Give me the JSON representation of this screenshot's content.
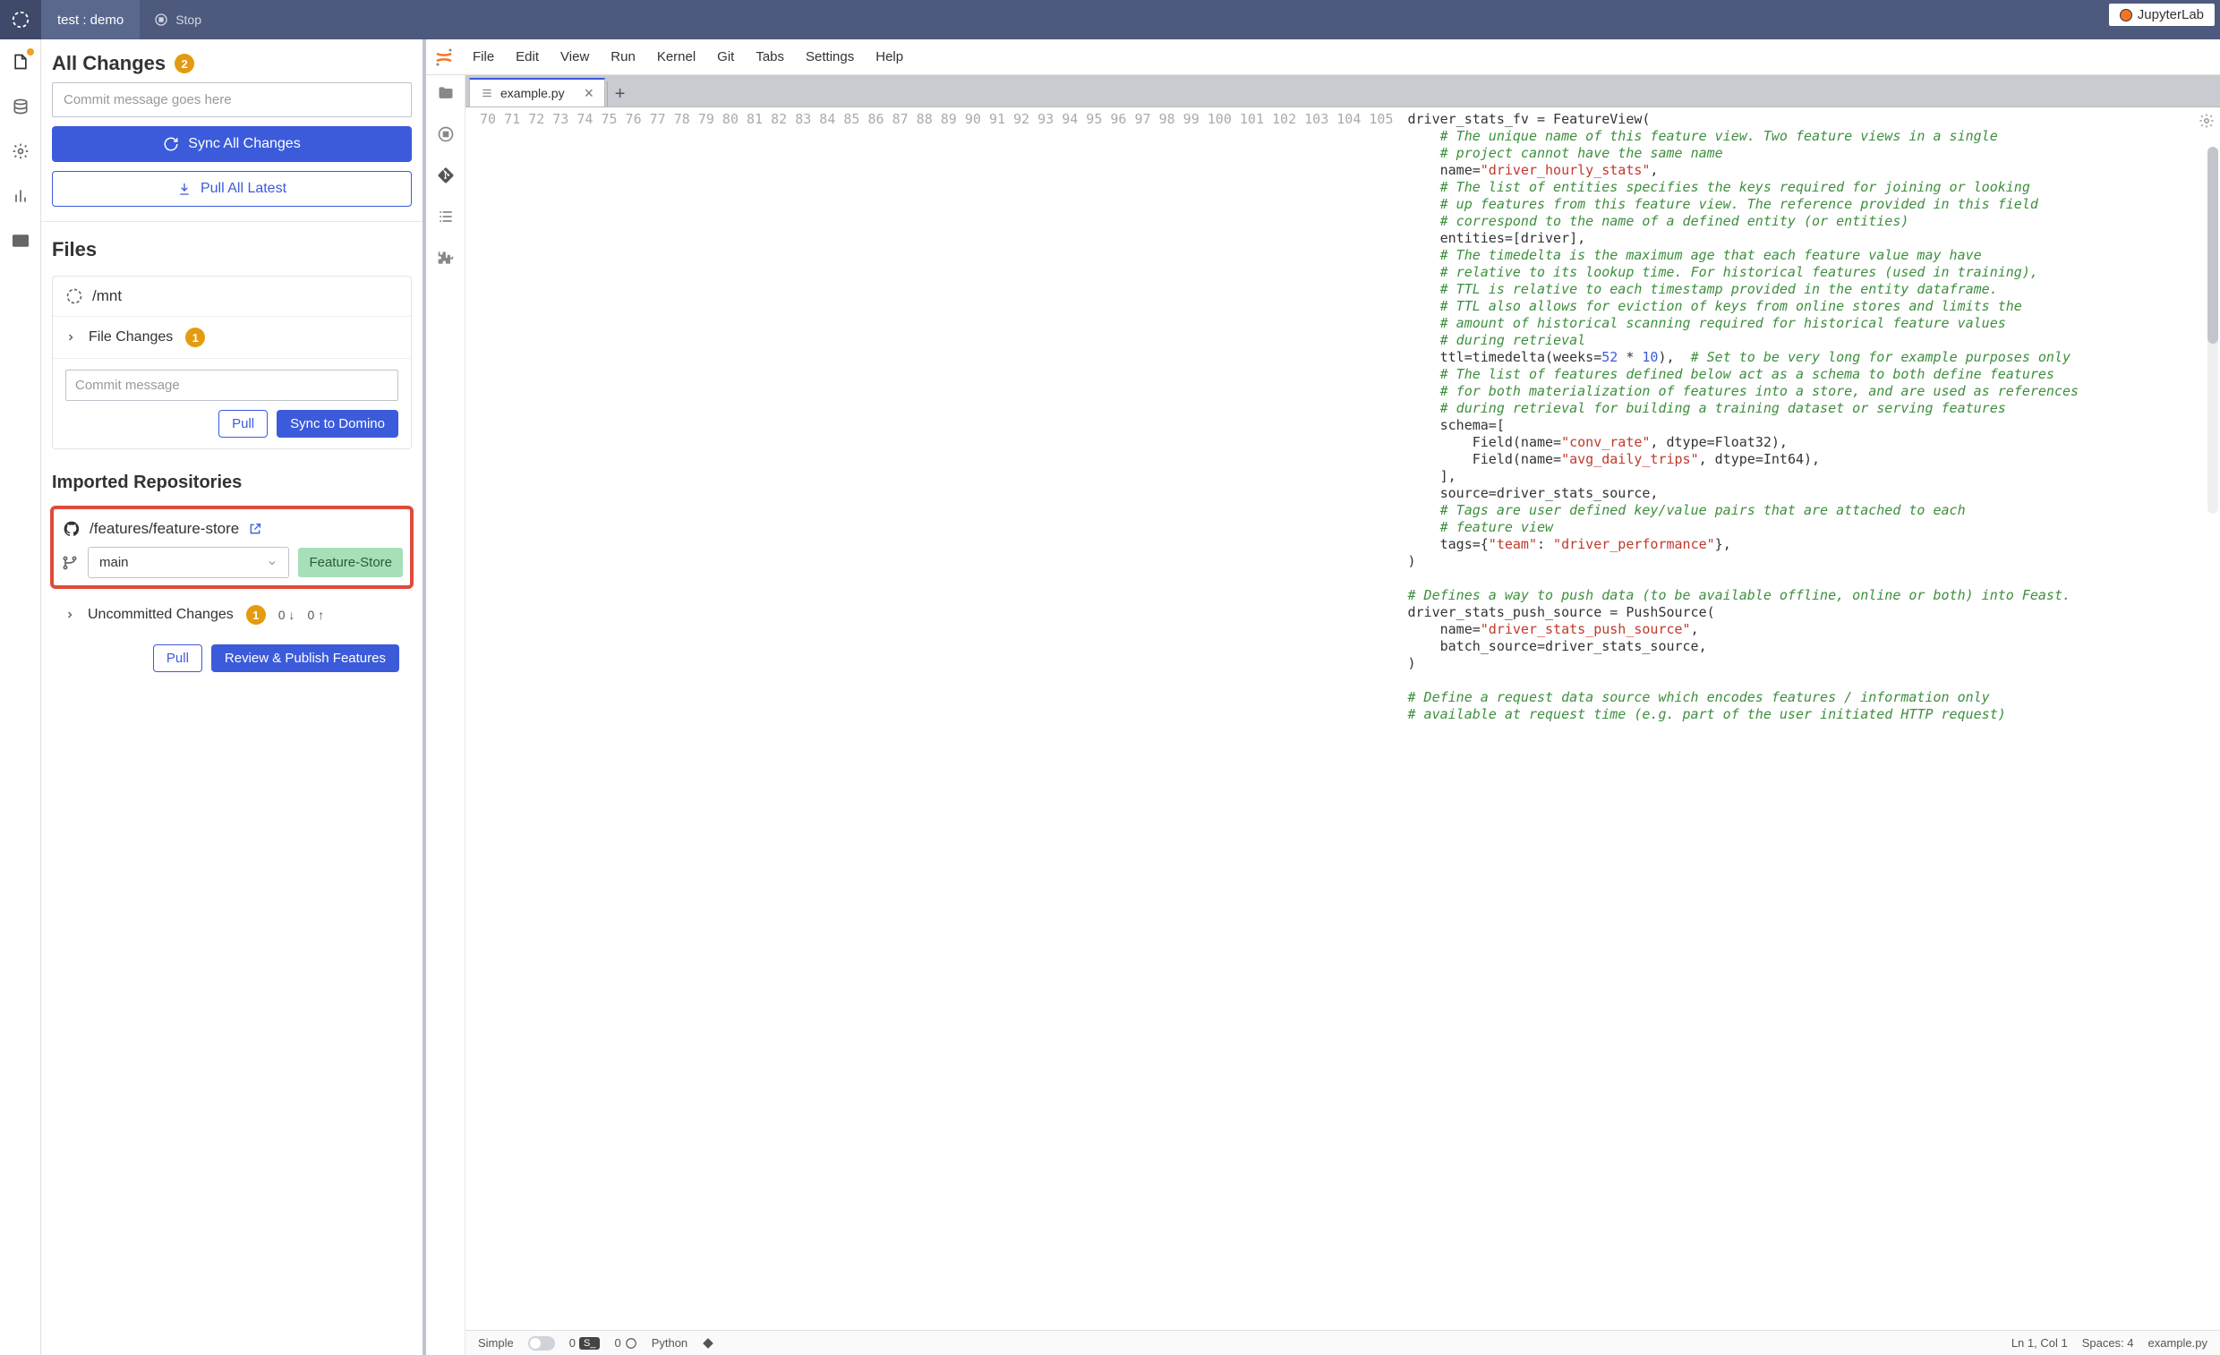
{
  "topbar": {
    "title": "test : demo",
    "stop": "Stop",
    "jlab": "JupyterLab"
  },
  "sidepanel": {
    "allchanges": {
      "title": "All Changes",
      "count": "2",
      "placeholder": "Commit message goes here",
      "sync": "Sync All Changes",
      "pull": "Pull All Latest"
    },
    "files": {
      "title": "Files",
      "path": "/mnt",
      "filechanges": "File Changes",
      "count": "1",
      "placeholder": "Commit message",
      "pull": "Pull",
      "sync": "Sync to Domino"
    },
    "repos": {
      "title": "Imported Repositories",
      "path": "/features/feature-store",
      "branch": "main",
      "tag": "Feature-Store",
      "uncommitted": "Uncommitted Changes",
      "ucount": "1",
      "down": "0 ↓",
      "up": "0 ↑",
      "pull": "Pull",
      "review": "Review & Publish Features"
    }
  },
  "menu": {
    "items": [
      "File",
      "Edit",
      "View",
      "Run",
      "Kernel",
      "Git",
      "Tabs",
      "Settings",
      "Help"
    ]
  },
  "tab": {
    "name": "example.py"
  },
  "status": {
    "simple": "Simple",
    "zero1": "0",
    "zero2": "0",
    "python": "Python",
    "lncol": "Ln 1, Col 1",
    "spaces": "Spaces: 4",
    "file": "example.py"
  },
  "code": {
    "start": 70,
    "lines": [
      {
        "t": "driver_stats_fv = FeatureView("
      },
      {
        "t": "    ",
        "c": "# The unique name of this feature view. Two feature views in a single"
      },
      {
        "t": "    ",
        "c": "# project cannot have the same name"
      },
      {
        "t": "    name=",
        "s": "\"driver_hourly_stats\"",
        "r": ","
      },
      {
        "t": "    ",
        "c": "# The list of entities specifies the keys required for joining or looking"
      },
      {
        "t": "    ",
        "c": "# up features from this feature view. The reference provided in this field"
      },
      {
        "t": "    ",
        "c": "# correspond to the name of a defined entity (or entities)"
      },
      {
        "t": "    entities=[driver],"
      },
      {
        "t": "    ",
        "c": "# The timedelta is the maximum age that each feature value may have"
      },
      {
        "t": "    ",
        "c": "# relative to its lookup time. For historical features (used in training),"
      },
      {
        "t": "    ",
        "c": "# TTL is relative to each timestamp provided in the entity dataframe."
      },
      {
        "t": "    ",
        "c": "# TTL also allows for eviction of keys from online stores and limits the"
      },
      {
        "t": "    ",
        "c": "# amount of historical scanning required for historical feature values"
      },
      {
        "t": "    ",
        "c": "# during retrieval"
      },
      {
        "html": "    ttl=timedelta(weeks=<span class='n'>52</span> * <span class='n'>10</span>),  <span class='c'># Set to be very long for example purposes only</span>"
      },
      {
        "t": "    ",
        "c": "# The list of features defined below act as a schema to both define features"
      },
      {
        "t": "    ",
        "c": "# for both materialization of features into a store, and are used as references"
      },
      {
        "t": "    ",
        "c": "# during retrieval for building a training dataset or serving features"
      },
      {
        "t": "    schema=["
      },
      {
        "html": "        Field(name=<span class='s'>\"conv_rate\"</span>, dtype=Float32),"
      },
      {
        "html": "        Field(name=<span class='s'>\"avg_daily_trips\"</span>, dtype=Int64),"
      },
      {
        "t": "    ],"
      },
      {
        "t": "    source=driver_stats_source,"
      },
      {
        "t": "    ",
        "c": "# Tags are user defined key/value pairs that are attached to each"
      },
      {
        "t": "    ",
        "c": "# feature view"
      },
      {
        "html": "    tags={<span class='s'>\"team\"</span>: <span class='s'>\"driver_performance\"</span>},"
      },
      {
        "t": ")"
      },
      {
        "t": ""
      },
      {
        "c": "# Defines a way to push data (to be available offline, online or both) into Feast."
      },
      {
        "t": "driver_stats_push_source = PushSource("
      },
      {
        "html": "    name=<span class='s'>\"driver_stats_push_source\"</span>,"
      },
      {
        "t": "    batch_source=driver_stats_source,"
      },
      {
        "t": ")"
      },
      {
        "t": ""
      },
      {
        "c": "# Define a request data source which encodes features / information only"
      },
      {
        "c": "# available at request time (e.g. part of the user initiated HTTP request)"
      }
    ]
  }
}
